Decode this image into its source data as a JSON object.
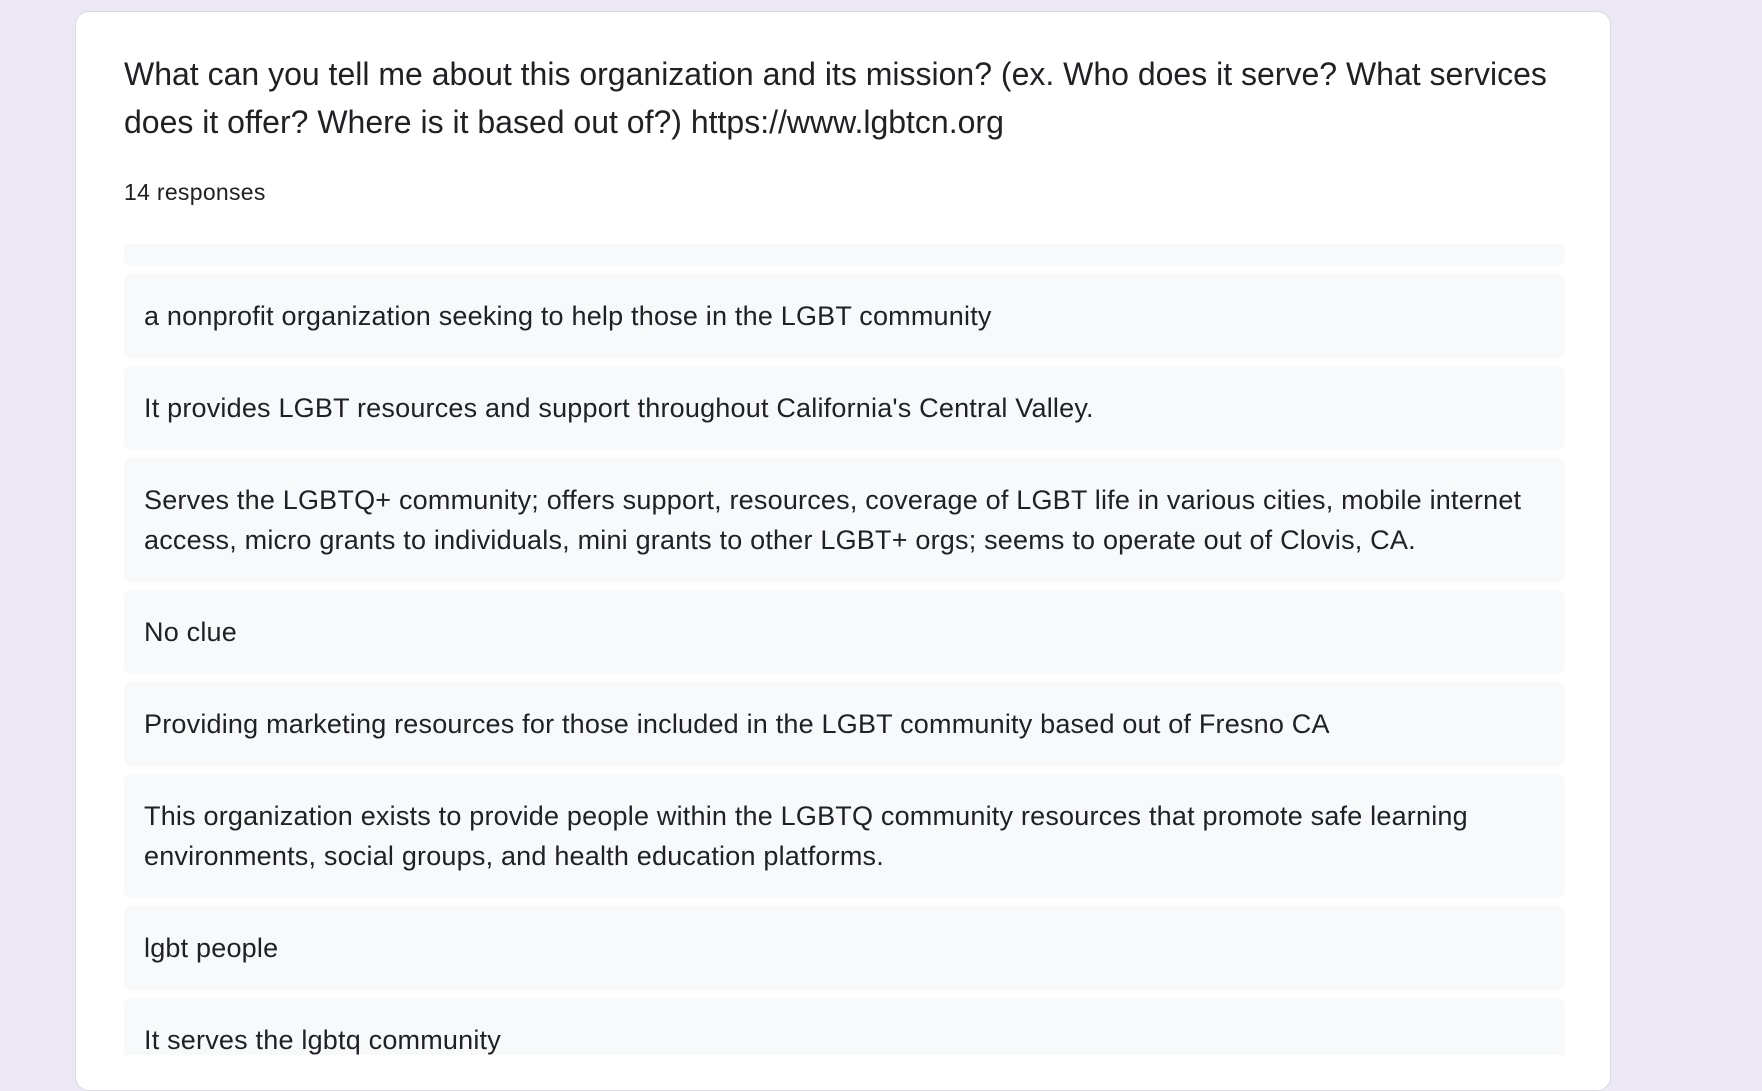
{
  "question": {
    "title": "What can you tell me about this organization and its mission? (ex. Who does it serve? What services does it offer? Where is it based out of?) https://www.lgbtcn.org",
    "response_count": "14 responses"
  },
  "responses": [
    "a nonprofit organization seeking to help those in the LGBT community",
    "It provides LGBT resources and support throughout California's Central Valley.",
    "Serves the LGBTQ+ community; offers support, resources, coverage of LGBT life in various cities, mobile internet access, micro grants to individuals, mini grants to other LGBT+ orgs; seems to operate out of Clovis, CA.",
    "No clue",
    "Providing marketing resources for those included in the LGBT community based out of Fresno CA",
    "This organization exists to provide people within the LGBTQ community resources that promote safe learning environments, social groups, and health education platforms.",
    "lgbt people",
    "It serves the lgbtq community"
  ]
}
